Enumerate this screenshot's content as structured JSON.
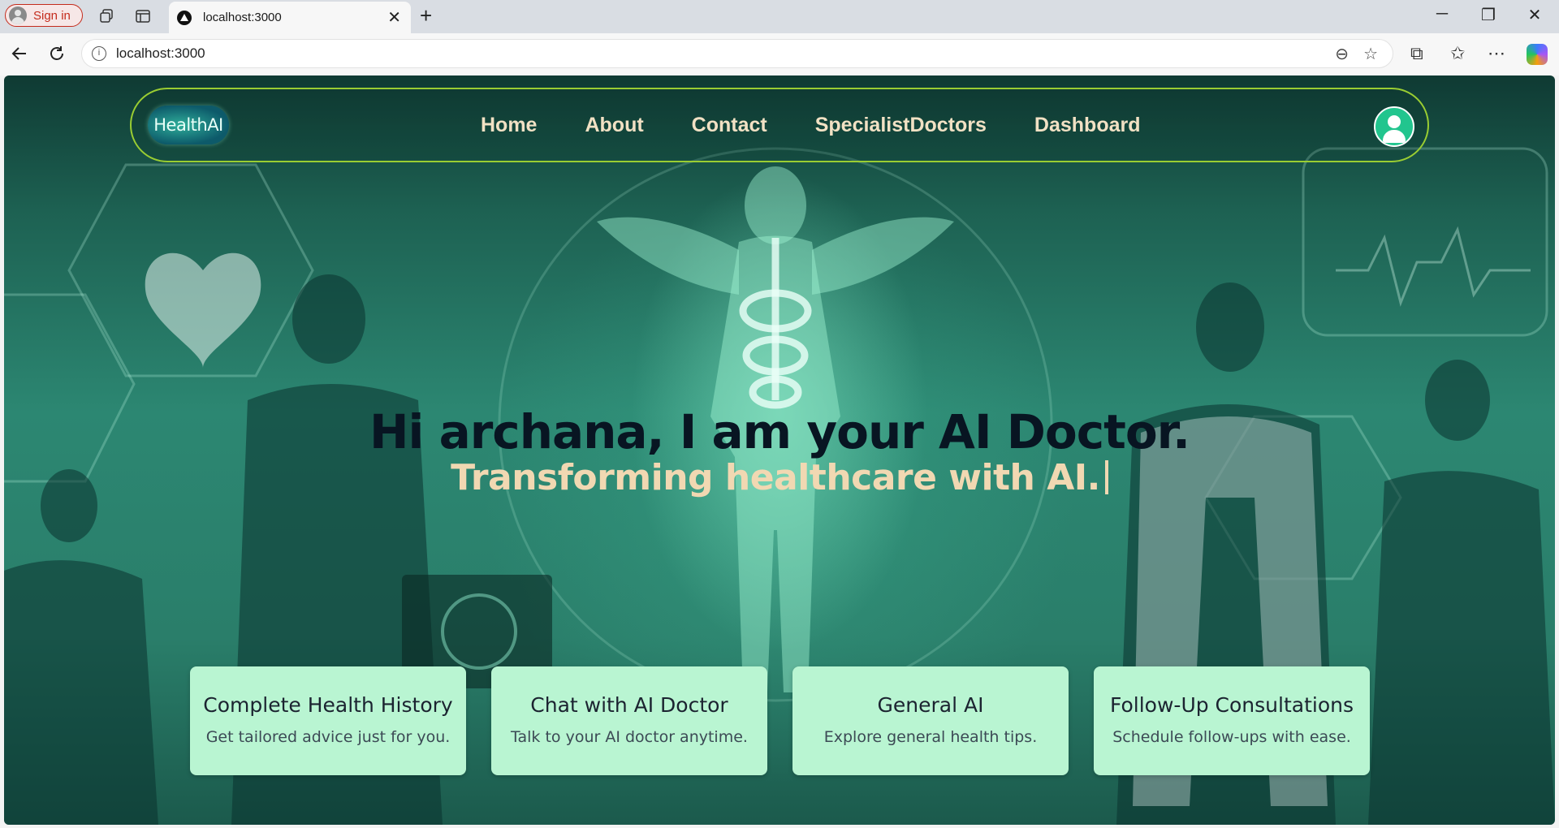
{
  "browser": {
    "sign_in_label": "Sign in",
    "tab_title": "localhost:3000",
    "url": "localhost:3000"
  },
  "navbar": {
    "logo_text": "HealthAI",
    "items": [
      {
        "label": "Home"
      },
      {
        "label": "About"
      },
      {
        "label": "Contact"
      },
      {
        "label": "SpecialistDoctors"
      },
      {
        "label": "Dashboard"
      }
    ],
    "accent_color": "#9acd32"
  },
  "hero": {
    "title": "Hi archana, I am your AI Doctor.",
    "subtitle": "Transforming healthcare with AI."
  },
  "cards": [
    {
      "title": "Complete Health History",
      "description": "Get tailored advice just for you."
    },
    {
      "title": "Chat with AI Doctor",
      "description": "Talk to your AI doctor anytime."
    },
    {
      "title": "General AI",
      "description": "Explore general health tips."
    },
    {
      "title": "Follow-Up Consultations",
      "description": "Schedule follow-ups with ease."
    }
  ],
  "colors": {
    "card_bg": "#b9f5d2",
    "menu_text": "#f1e1c4",
    "user_icon_bg": "#22c58e"
  }
}
